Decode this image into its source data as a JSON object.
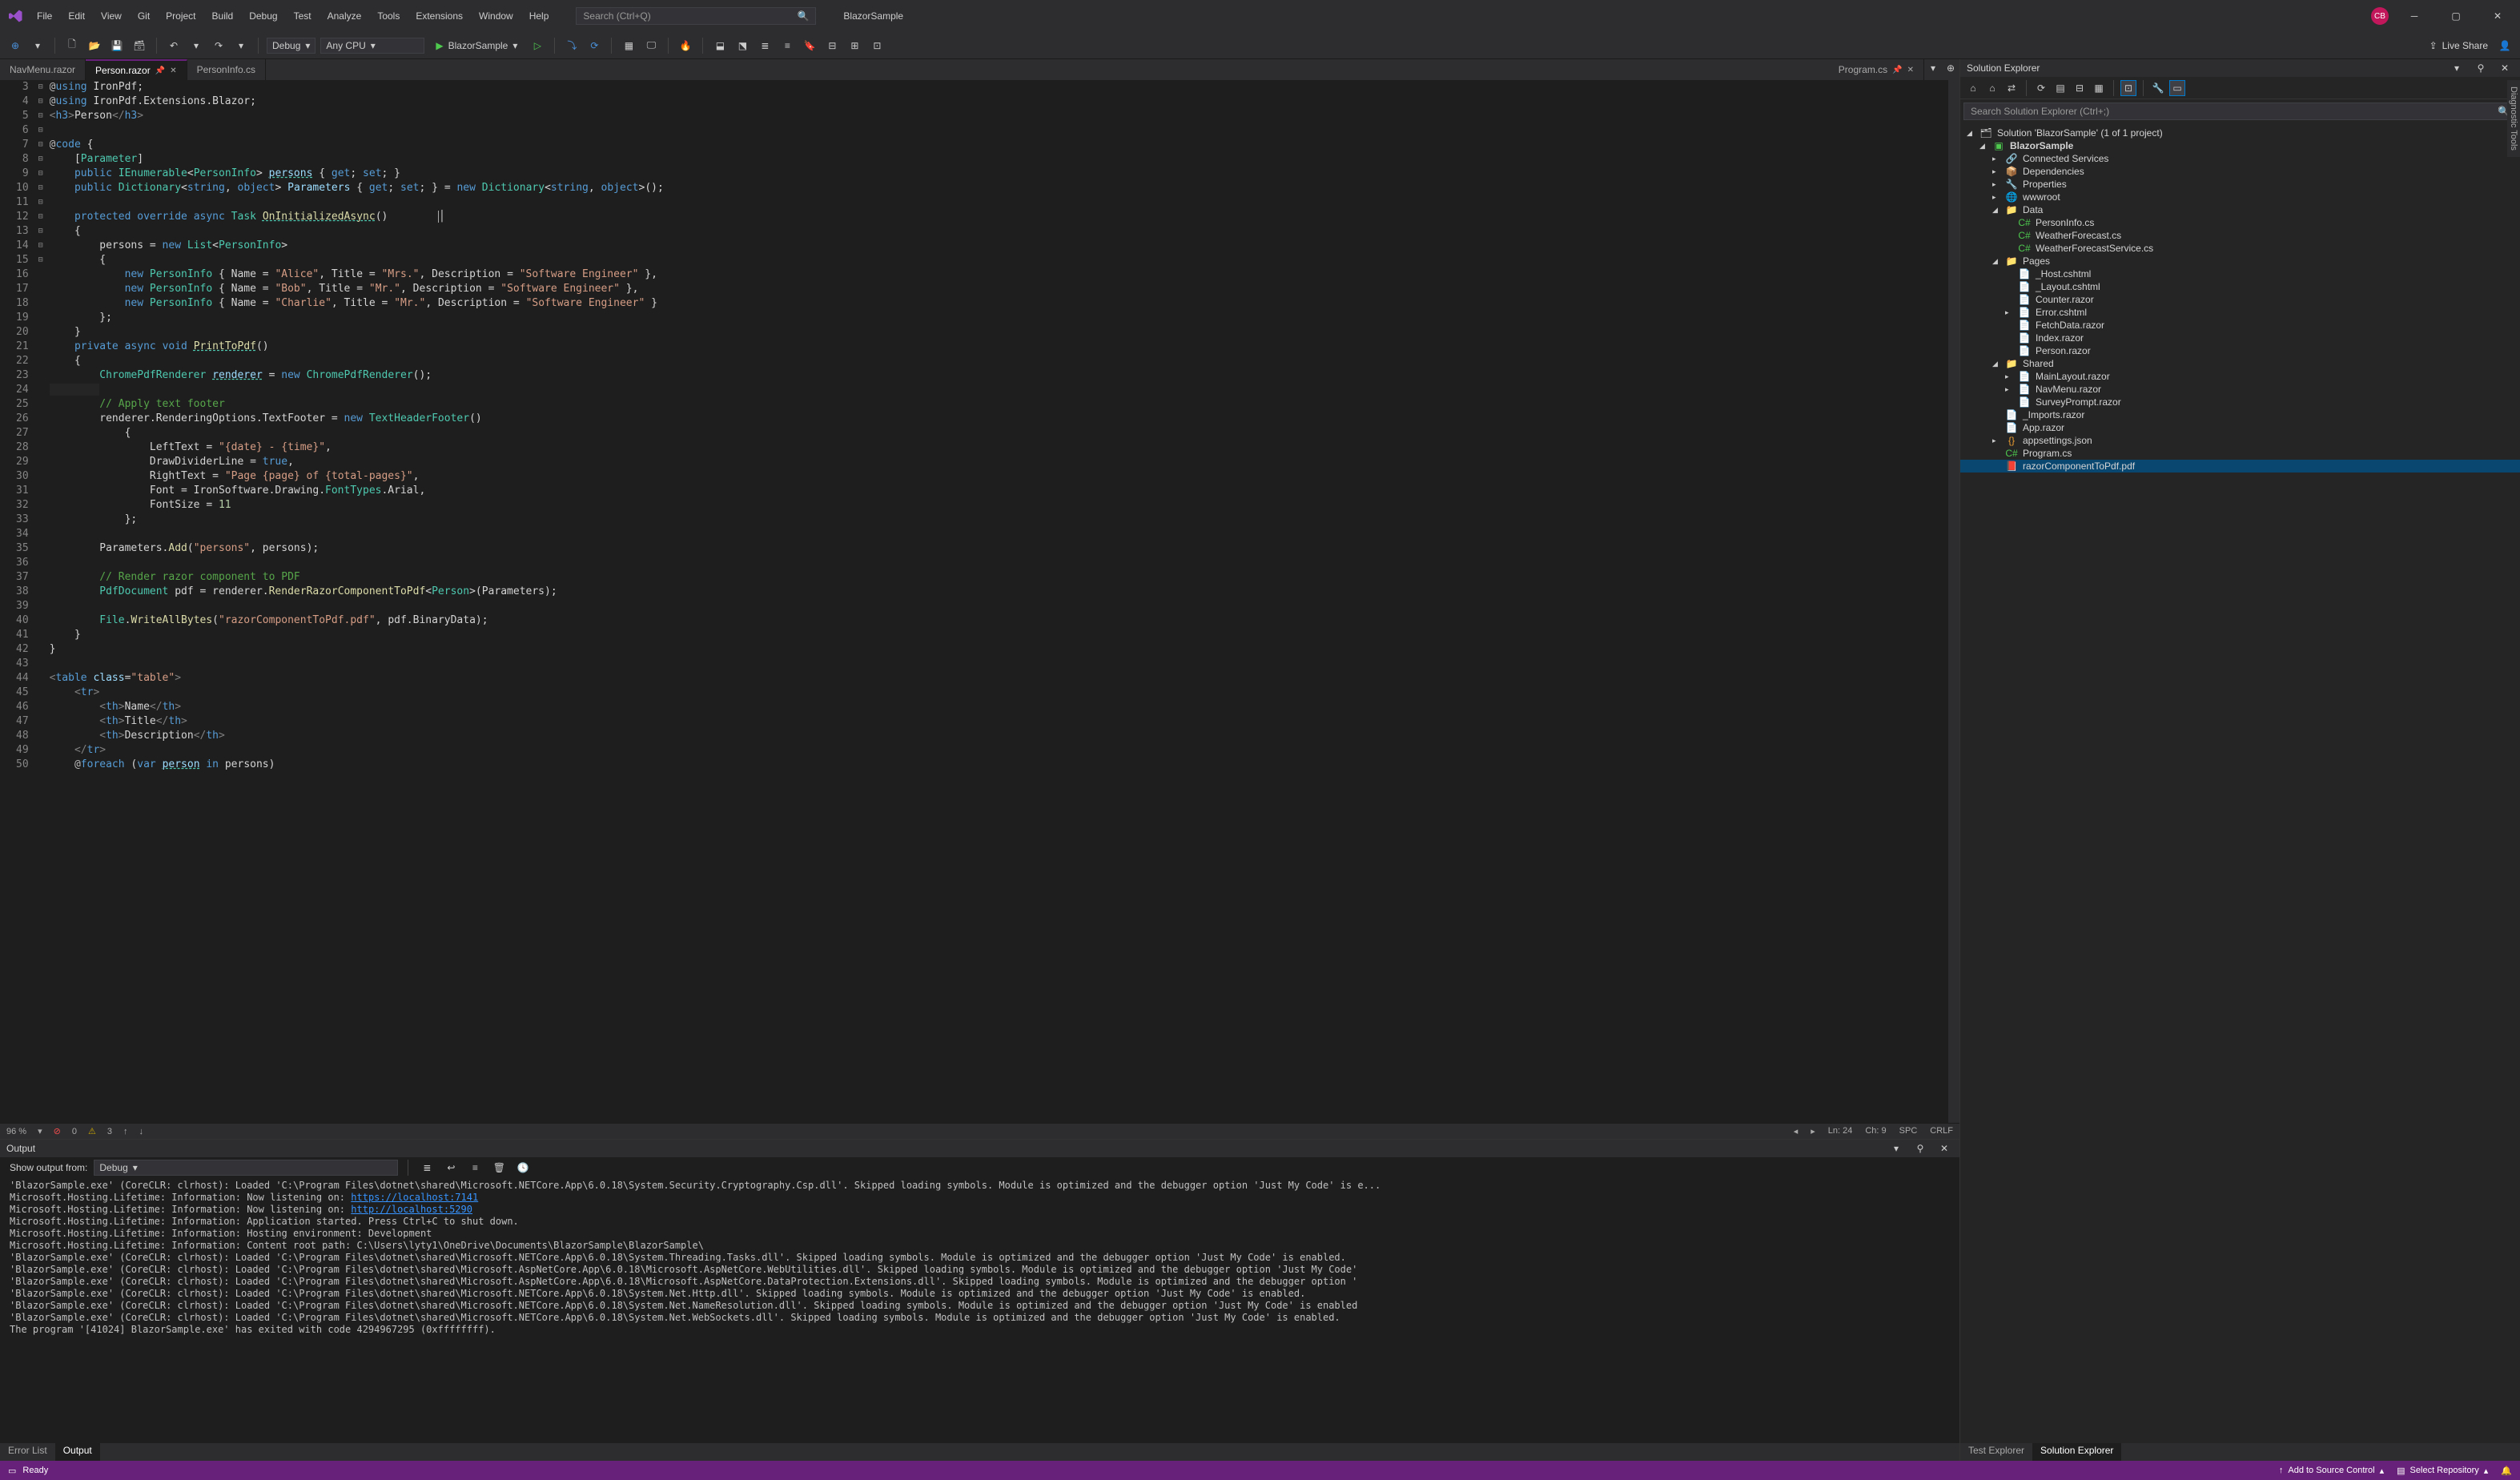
{
  "app": {
    "title": "BlazorSample"
  },
  "menu": [
    "File",
    "Edit",
    "View",
    "Git",
    "Project",
    "Build",
    "Debug",
    "Test",
    "Analyze",
    "Tools",
    "Extensions",
    "Window",
    "Help"
  ],
  "search": {
    "placeholder": "Search (Ctrl+Q)"
  },
  "avatar": "CB",
  "toolbar": {
    "config": "Debug",
    "platform": "Any CPU",
    "start": "BlazorSample",
    "liveshare": "Live Share"
  },
  "tabs": {
    "left": [
      {
        "label": "NavMenu.razor",
        "active": false
      },
      {
        "label": "Person.razor",
        "active": true,
        "pinned": true
      },
      {
        "label": "PersonInfo.cs",
        "active": false
      }
    ],
    "right": [
      {
        "label": "Program.cs",
        "active": false
      }
    ]
  },
  "editor": {
    "zoom": "96 %",
    "errors": "0",
    "warnings": "3",
    "ln": "Ln: 24",
    "ch": "Ch: 9",
    "spc": "SPC",
    "crlf": "CRLF",
    "lines_start": 3,
    "lines_end": 50
  },
  "output": {
    "title": "Output",
    "from_label": "Show output from:",
    "from_value": "Debug",
    "text": "'BlazorSample.exe' (CoreCLR: clrhost): Loaded 'C:\\Program Files\\dotnet\\shared\\Microsoft.NETCore.App\\6.0.18\\System.Security.Cryptography.Csp.dll'. Skipped loading symbols. Module is optimized and the debugger option 'Just My Code' is e...\nMicrosoft.Hosting.Lifetime: Information: Now listening on: https://localhost:7141\nMicrosoft.Hosting.Lifetime: Information: Now listening on: http://localhost:5290\nMicrosoft.Hosting.Lifetime: Information: Application started. Press Ctrl+C to shut down.\nMicrosoft.Hosting.Lifetime: Information: Hosting environment: Development\nMicrosoft.Hosting.Lifetime: Information: Content root path: C:\\Users\\lyty1\\OneDrive\\Documents\\BlazorSample\\BlazorSample\\\n'BlazorSample.exe' (CoreCLR: clrhost): Loaded 'C:\\Program Files\\dotnet\\shared\\Microsoft.NETCore.App\\6.0.18\\System.Threading.Tasks.dll'. Skipped loading symbols. Module is optimized and the debugger option 'Just My Code' is enabled.\n'BlazorSample.exe' (CoreCLR: clrhost): Loaded 'C:\\Program Files\\dotnet\\shared\\Microsoft.AspNetCore.App\\6.0.18\\Microsoft.AspNetCore.WebUtilities.dll'. Skipped loading symbols. Module is optimized and the debugger option 'Just My Code'\n'BlazorSample.exe' (CoreCLR: clrhost): Loaded 'C:\\Program Files\\dotnet\\shared\\Microsoft.AspNetCore.App\\6.0.18\\Microsoft.AspNetCore.DataProtection.Extensions.dll'. Skipped loading symbols. Module is optimized and the debugger option '\n'BlazorSample.exe' (CoreCLR: clrhost): Loaded 'C:\\Program Files\\dotnet\\shared\\Microsoft.NETCore.App\\6.0.18\\System.Net.Http.dll'. Skipped loading symbols. Module is optimized and the debugger option 'Just My Code' is enabled.\n'BlazorSample.exe' (CoreCLR: clrhost): Loaded 'C:\\Program Files\\dotnet\\shared\\Microsoft.NETCore.App\\6.0.18\\System.Net.NameResolution.dll'. Skipped loading symbols. Module is optimized and the debugger option 'Just My Code' is enabled\n'BlazorSample.exe' (CoreCLR: clrhost): Loaded 'C:\\Program Files\\dotnet\\shared\\Microsoft.NETCore.App\\6.0.18\\System.Net.WebSockets.dll'. Skipped loading symbols. Module is optimized and the debugger option 'Just My Code' is enabled.\nThe program '[41024] BlazorSample.exe' has exited with code 4294967295 (0xffffffff)."
  },
  "bottom_tabs_left": [
    "Error List",
    "Output"
  ],
  "bottom_tabs_left_active": "Output",
  "solution": {
    "title": "Solution Explorer",
    "search": "Search Solution Explorer (Ctrl+;)",
    "root": "Solution 'BlazorSample' (1 of 1 project)",
    "project": "BlazorSample",
    "nodes": {
      "connected": "Connected Services",
      "deps": "Dependencies",
      "props": "Properties",
      "wwwroot": "wwwroot",
      "data": "Data",
      "data_items": [
        "PersonInfo.cs",
        "WeatherForecast.cs",
        "WeatherForecastService.cs"
      ],
      "pages": "Pages",
      "pages_items": [
        "_Host.cshtml",
        "_Layout.cshtml",
        "Counter.razor",
        "Error.cshtml",
        "FetchData.razor",
        "Index.razor",
        "Person.razor"
      ],
      "shared": "Shared",
      "shared_items": [
        "MainLayout.razor",
        "NavMenu.razor",
        "SurveyPrompt.razor"
      ],
      "root_files": [
        "_Imports.razor",
        "App.razor",
        "appsettings.json",
        "Program.cs",
        "razorComponentToPdf.pdf"
      ]
    }
  },
  "bottom_tabs_right": [
    "Test Explorer",
    "Solution Explorer"
  ],
  "bottom_tabs_right_active": "Solution Explorer",
  "status": {
    "ready": "Ready",
    "source": "Add to Source Control",
    "repo": "Select Repository"
  },
  "vertical": "Diagnostic Tools"
}
